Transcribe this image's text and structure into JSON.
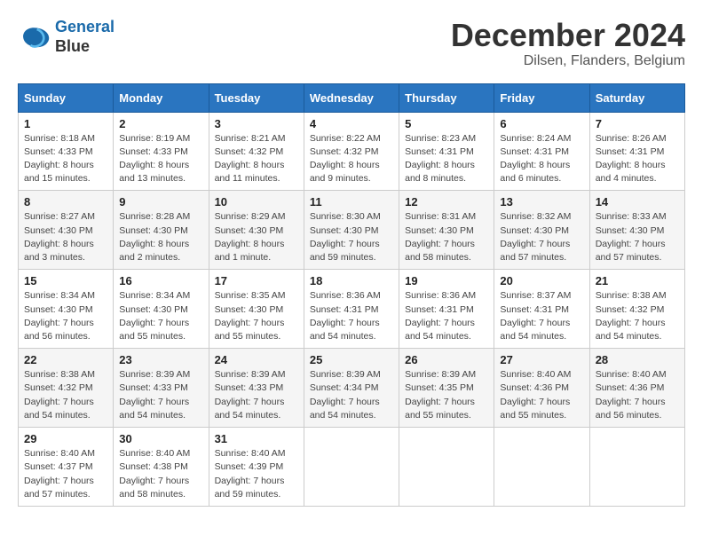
{
  "logo": {
    "line1": "General",
    "line2": "Blue"
  },
  "title": "December 2024",
  "subtitle": "Dilsen, Flanders, Belgium",
  "days_header": [
    "Sunday",
    "Monday",
    "Tuesday",
    "Wednesday",
    "Thursday",
    "Friday",
    "Saturday"
  ],
  "weeks": [
    [
      {
        "day": "1",
        "sunrise": "8:18 AM",
        "sunset": "4:33 PM",
        "daylight": "8 hours and 15 minutes."
      },
      {
        "day": "2",
        "sunrise": "8:19 AM",
        "sunset": "4:33 PM",
        "daylight": "8 hours and 13 minutes."
      },
      {
        "day": "3",
        "sunrise": "8:21 AM",
        "sunset": "4:32 PM",
        "daylight": "8 hours and 11 minutes."
      },
      {
        "day": "4",
        "sunrise": "8:22 AM",
        "sunset": "4:32 PM",
        "daylight": "8 hours and 9 minutes."
      },
      {
        "day": "5",
        "sunrise": "8:23 AM",
        "sunset": "4:31 PM",
        "daylight": "8 hours and 8 minutes."
      },
      {
        "day": "6",
        "sunrise": "8:24 AM",
        "sunset": "4:31 PM",
        "daylight": "8 hours and 6 minutes."
      },
      {
        "day": "7",
        "sunrise": "8:26 AM",
        "sunset": "4:31 PM",
        "daylight": "8 hours and 4 minutes."
      }
    ],
    [
      {
        "day": "8",
        "sunrise": "8:27 AM",
        "sunset": "4:30 PM",
        "daylight": "8 hours and 3 minutes."
      },
      {
        "day": "9",
        "sunrise": "8:28 AM",
        "sunset": "4:30 PM",
        "daylight": "8 hours and 2 minutes."
      },
      {
        "day": "10",
        "sunrise": "8:29 AM",
        "sunset": "4:30 PM",
        "daylight": "8 hours and 1 minute."
      },
      {
        "day": "11",
        "sunrise": "8:30 AM",
        "sunset": "4:30 PM",
        "daylight": "7 hours and 59 minutes."
      },
      {
        "day": "12",
        "sunrise": "8:31 AM",
        "sunset": "4:30 PM",
        "daylight": "7 hours and 58 minutes."
      },
      {
        "day": "13",
        "sunrise": "8:32 AM",
        "sunset": "4:30 PM",
        "daylight": "7 hours and 57 minutes."
      },
      {
        "day": "14",
        "sunrise": "8:33 AM",
        "sunset": "4:30 PM",
        "daylight": "7 hours and 57 minutes."
      }
    ],
    [
      {
        "day": "15",
        "sunrise": "8:34 AM",
        "sunset": "4:30 PM",
        "daylight": "7 hours and 56 minutes."
      },
      {
        "day": "16",
        "sunrise": "8:34 AM",
        "sunset": "4:30 PM",
        "daylight": "7 hours and 55 minutes."
      },
      {
        "day": "17",
        "sunrise": "8:35 AM",
        "sunset": "4:30 PM",
        "daylight": "7 hours and 55 minutes."
      },
      {
        "day": "18",
        "sunrise": "8:36 AM",
        "sunset": "4:31 PM",
        "daylight": "7 hours and 54 minutes."
      },
      {
        "day": "19",
        "sunrise": "8:36 AM",
        "sunset": "4:31 PM",
        "daylight": "7 hours and 54 minutes."
      },
      {
        "day": "20",
        "sunrise": "8:37 AM",
        "sunset": "4:31 PM",
        "daylight": "7 hours and 54 minutes."
      },
      {
        "day": "21",
        "sunrise": "8:38 AM",
        "sunset": "4:32 PM",
        "daylight": "7 hours and 54 minutes."
      }
    ],
    [
      {
        "day": "22",
        "sunrise": "8:38 AM",
        "sunset": "4:32 PM",
        "daylight": "7 hours and 54 minutes."
      },
      {
        "day": "23",
        "sunrise": "8:39 AM",
        "sunset": "4:33 PM",
        "daylight": "7 hours and 54 minutes."
      },
      {
        "day": "24",
        "sunrise": "8:39 AM",
        "sunset": "4:33 PM",
        "daylight": "7 hours and 54 minutes."
      },
      {
        "day": "25",
        "sunrise": "8:39 AM",
        "sunset": "4:34 PM",
        "daylight": "7 hours and 54 minutes."
      },
      {
        "day": "26",
        "sunrise": "8:39 AM",
        "sunset": "4:35 PM",
        "daylight": "7 hours and 55 minutes."
      },
      {
        "day": "27",
        "sunrise": "8:40 AM",
        "sunset": "4:36 PM",
        "daylight": "7 hours and 55 minutes."
      },
      {
        "day": "28",
        "sunrise": "8:40 AM",
        "sunset": "4:36 PM",
        "daylight": "7 hours and 56 minutes."
      }
    ],
    [
      {
        "day": "29",
        "sunrise": "8:40 AM",
        "sunset": "4:37 PM",
        "daylight": "7 hours and 57 minutes."
      },
      {
        "day": "30",
        "sunrise": "8:40 AM",
        "sunset": "4:38 PM",
        "daylight": "7 hours and 58 minutes."
      },
      {
        "day": "31",
        "sunrise": "8:40 AM",
        "sunset": "4:39 PM",
        "daylight": "7 hours and 59 minutes."
      },
      null,
      null,
      null,
      null
    ]
  ]
}
